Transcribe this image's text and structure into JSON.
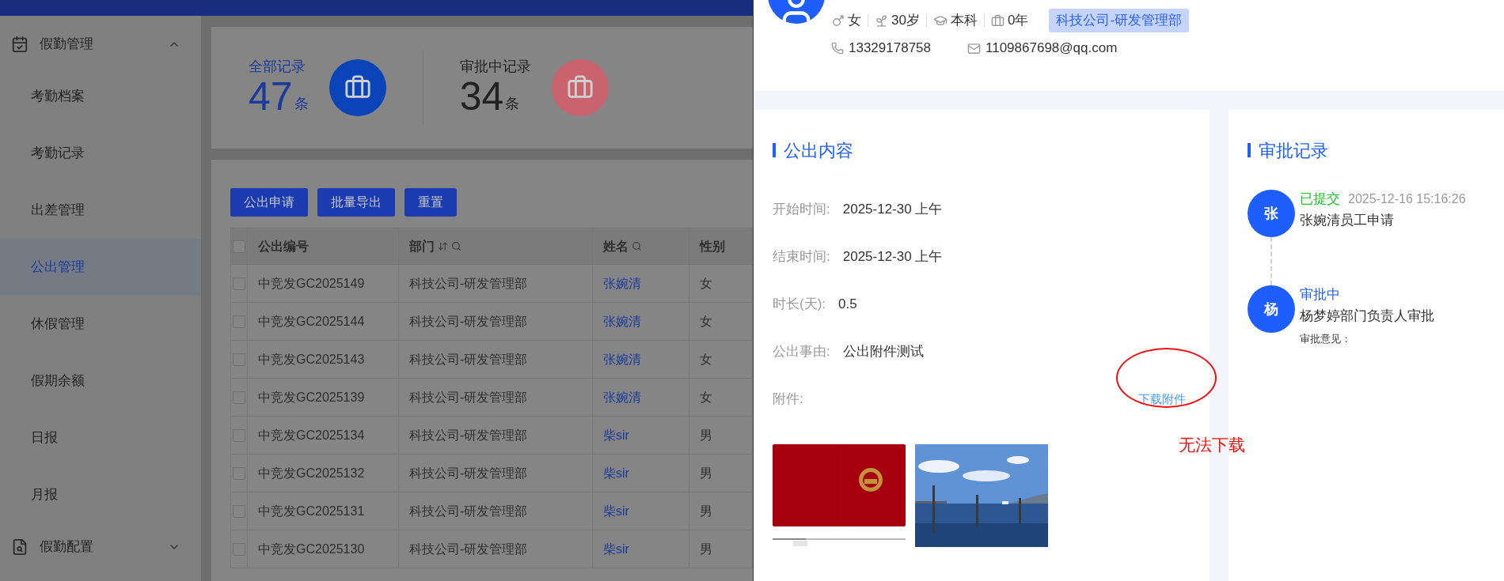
{
  "sidebar": {
    "groups": [
      {
        "label": "假勤管理",
        "expanded": true,
        "items": [
          {
            "label": "考勤档案",
            "selected": false
          },
          {
            "label": "考勤记录",
            "selected": false
          },
          {
            "label": "出差管理",
            "selected": false
          },
          {
            "label": "公出管理",
            "selected": true
          },
          {
            "label": "休假管理",
            "selected": false
          },
          {
            "label": "假期余额",
            "selected": false
          },
          {
            "label": "日报",
            "selected": false
          },
          {
            "label": "月报",
            "selected": false
          }
        ]
      },
      {
        "label": "假勤配置",
        "expanded": false
      }
    ]
  },
  "stats": [
    {
      "label": "全部记录",
      "value": "47",
      "unit": "条",
      "selected": true,
      "color": "#0b44b8"
    },
    {
      "label": "审批中记录",
      "value": "34",
      "unit": "条",
      "selected": false,
      "color": "#c9646f"
    }
  ],
  "toolbar": {
    "buttons": [
      "公出申请",
      "批量导出",
      "重置"
    ]
  },
  "table": {
    "all_checked": false,
    "columns": [
      {
        "label": "公出编号",
        "sort": false,
        "filter": false
      },
      {
        "label": "部门",
        "sort": true,
        "filter": true
      },
      {
        "label": "姓名",
        "sort": false,
        "filter": true
      },
      {
        "label": "性别",
        "sort": false,
        "filter": false
      }
    ],
    "rows": [
      {
        "code": "中竞发GC2025149",
        "department": "科技公司-研发管理部",
        "name": "张婉清",
        "gender": "女",
        "checked": false
      },
      {
        "code": "中竞发GC2025144",
        "department": "科技公司-研发管理部",
        "name": "张婉清",
        "gender": "女",
        "checked": false
      },
      {
        "code": "中竞发GC2025143",
        "department": "科技公司-研发管理部",
        "name": "张婉清",
        "gender": "女",
        "checked": false
      },
      {
        "code": "中竞发GC2025139",
        "department": "科技公司-研发管理部",
        "name": "张婉清",
        "gender": "女",
        "checked": false
      },
      {
        "code": "中竞发GC2025134",
        "department": "科技公司-研发管理部",
        "name": "柴sir",
        "gender": "男",
        "checked": false
      },
      {
        "code": "中竞发GC2025132",
        "department": "科技公司-研发管理部",
        "name": "柴sir",
        "gender": "男",
        "checked": false
      },
      {
        "code": "中竞发GC2025131",
        "department": "科技公司-研发管理部",
        "name": "柴sir",
        "gender": "男",
        "checked": false
      },
      {
        "code": "中竞发GC2025130",
        "department": "科技公司-研发管理部",
        "name": "柴sir",
        "gender": "男",
        "checked": false
      }
    ]
  },
  "drawer": {
    "profile": {
      "gender": "女",
      "age": "30岁",
      "education": "本科",
      "experience": "0年",
      "department": "科技公司-研发管理部",
      "phone": "13329178758",
      "email": "1109867698@qq.com"
    },
    "details": {
      "title": "公出内容",
      "fields": [
        {
          "label": "开始时间:",
          "value": "2025-12-30 上午"
        },
        {
          "label": "结束时间:",
          "value": "2025-12-30 上午"
        },
        {
          "label": "时长(天):",
          "value": "0.5"
        },
        {
          "label": "公出事由:",
          "value": "公出附件测试"
        }
      ],
      "attachments_label": "附件:",
      "download_link": {
        "label": "下载附件",
        "circled": true
      }
    },
    "approval": {
      "title": "审批记录",
      "steps": [
        {
          "avatar": "张",
          "status": "已提交",
          "color": "#19c22a",
          "time": "2025-12-16 15:16:26",
          "text": "张婉清员工申请"
        },
        {
          "avatar": "杨",
          "status": "审批中",
          "color": "#1e5eff",
          "text": "杨梦婷部门负责人审批",
          "comment_label": "审批意见："
        }
      ]
    },
    "note": "无法下载"
  }
}
